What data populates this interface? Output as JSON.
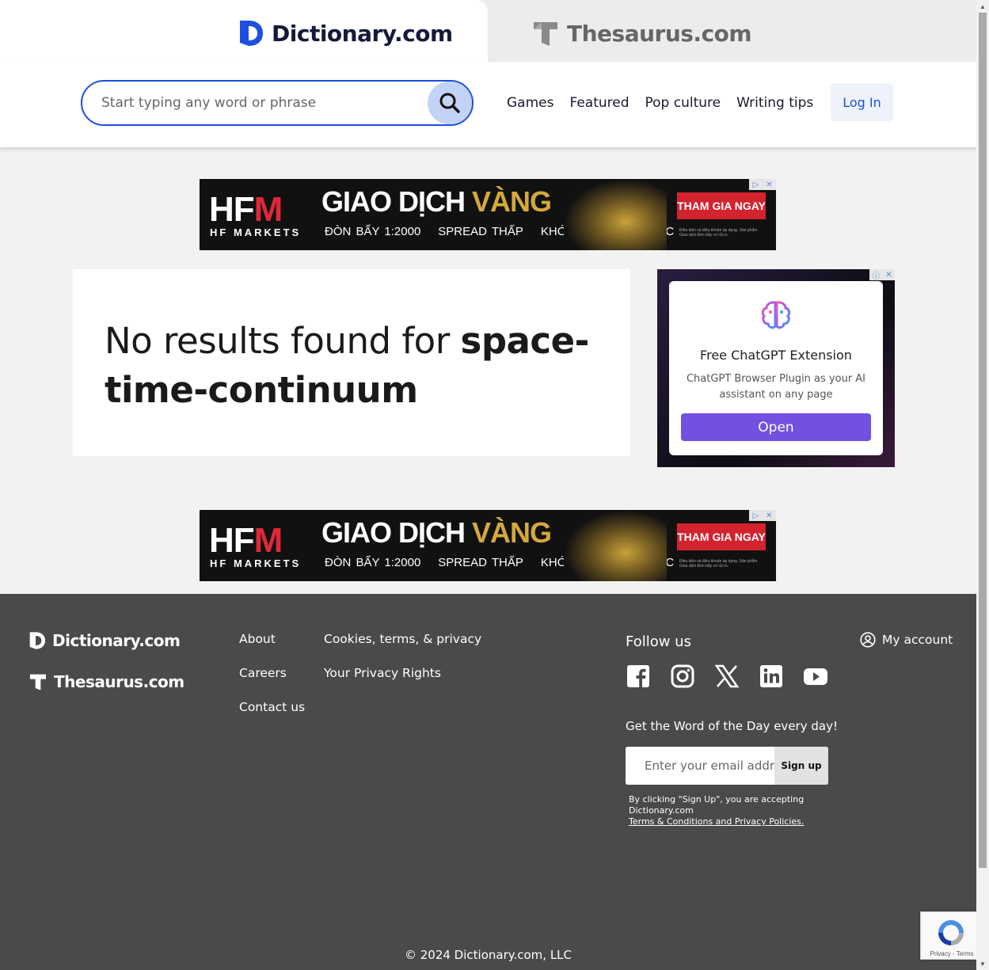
{
  "tabs": {
    "dictionary": "Dictionary.com",
    "thesaurus": "Thesaurus.com"
  },
  "search": {
    "placeholder": "Start typing any word or phrase"
  },
  "nav": [
    "Games",
    "Featured",
    "Pop culture",
    "Writing tips"
  ],
  "login_label": "Log In",
  "banner_ad": {
    "brand_left": "HF",
    "brand_right": "M",
    "brand_sub": "HF MARKETS",
    "headline_white": "GIAO DỊCH",
    "headline_gold": "VÀNG",
    "points": [
      "ĐÒN BẨY 1:2000",
      "SPREAD THẤP",
      "KHỚP LỆNH SIÊU TỐC"
    ],
    "cta": "THAM GIA NGAY",
    "fine_print": "Điều kiện và điều khoản áp dụng. Sản phẩm Giao dịch Đòn bẩy có rủi ro."
  },
  "no_results": {
    "prefix": "No results found for ",
    "term": "space-time-continuum"
  },
  "side_ad": {
    "title": "Free ChatGPT Extension",
    "desc": "ChatGPT Browser Plugin as your AI assistant on any page",
    "button": "Open"
  },
  "footer": {
    "logo_dictionary": "Dictionary.com",
    "logo_thesaurus": "Thesaurus.com",
    "col1": [
      "About",
      "Careers",
      "Contact us"
    ],
    "col2": [
      "Cookies, terms, & privacy",
      "Your Privacy Rights"
    ],
    "follow_us": "Follow us",
    "socials": [
      "facebook-icon",
      "instagram-icon",
      "x-icon",
      "linkedin-icon",
      "youtube-icon"
    ],
    "wotd": "Get the Word of the Day every day!",
    "email_placeholder": "Enter your email address",
    "signup": "Sign up",
    "legal_text": "By clicking \"Sign Up\", you are accepting Dictionary.com",
    "legal_link": "Terms & Conditions and Privacy Policies.",
    "my_account": "My account",
    "copyright": "© 2024 Dictionary.com, LLC"
  },
  "recaptcha": "Privacy - Terms",
  "colors": {
    "brand_blue": "#1c4fe0",
    "footer_bg": "#4a4a4a",
    "ad_purple": "#7350e0"
  }
}
